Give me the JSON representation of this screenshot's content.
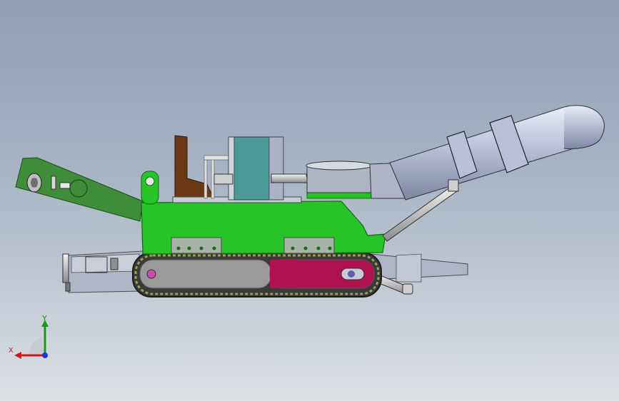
{
  "triad": {
    "x_label": "X",
    "y_label": "Y",
    "colors": {
      "x": "#d01818",
      "y": "#1a9a1a",
      "z": "#1a3ad0"
    }
  },
  "colors": {
    "background_top": "#8f9eb3",
    "background_bottom": "#dde1e6",
    "body_green": "#27c427",
    "dark_green": "#3f8c3a",
    "track_grey": "#9a9a9a",
    "accent_magenta": "#b0114f",
    "cylinder_grey": "#b9bfd6",
    "teal_box": "#4a9b98",
    "brown_bracket": "#6b3a14"
  }
}
